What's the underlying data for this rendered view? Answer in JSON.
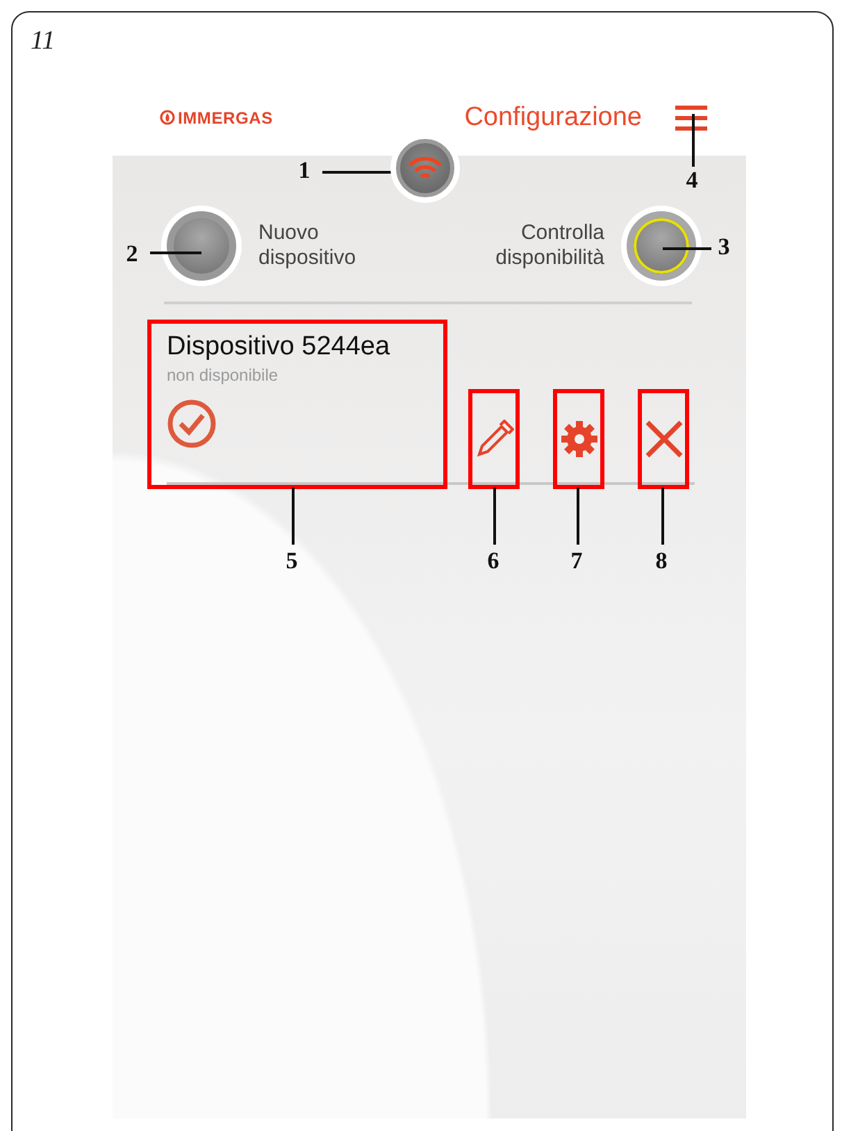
{
  "figure_number": "11",
  "header": {
    "logo_text": "IMMERGAS",
    "title": "Configurazione"
  },
  "actions": [
    {
      "kind": "new",
      "label": "Nuovo dispositivo",
      "highlighted": false
    },
    {
      "kind": "check",
      "label": "Controlla disponibilità",
      "highlighted": true
    }
  ],
  "device": {
    "name": "Dispositivo 5244ea",
    "status": "non disponibile"
  },
  "callouts": [
    "1",
    "2",
    "3",
    "4",
    "5",
    "6",
    "7",
    "8"
  ]
}
